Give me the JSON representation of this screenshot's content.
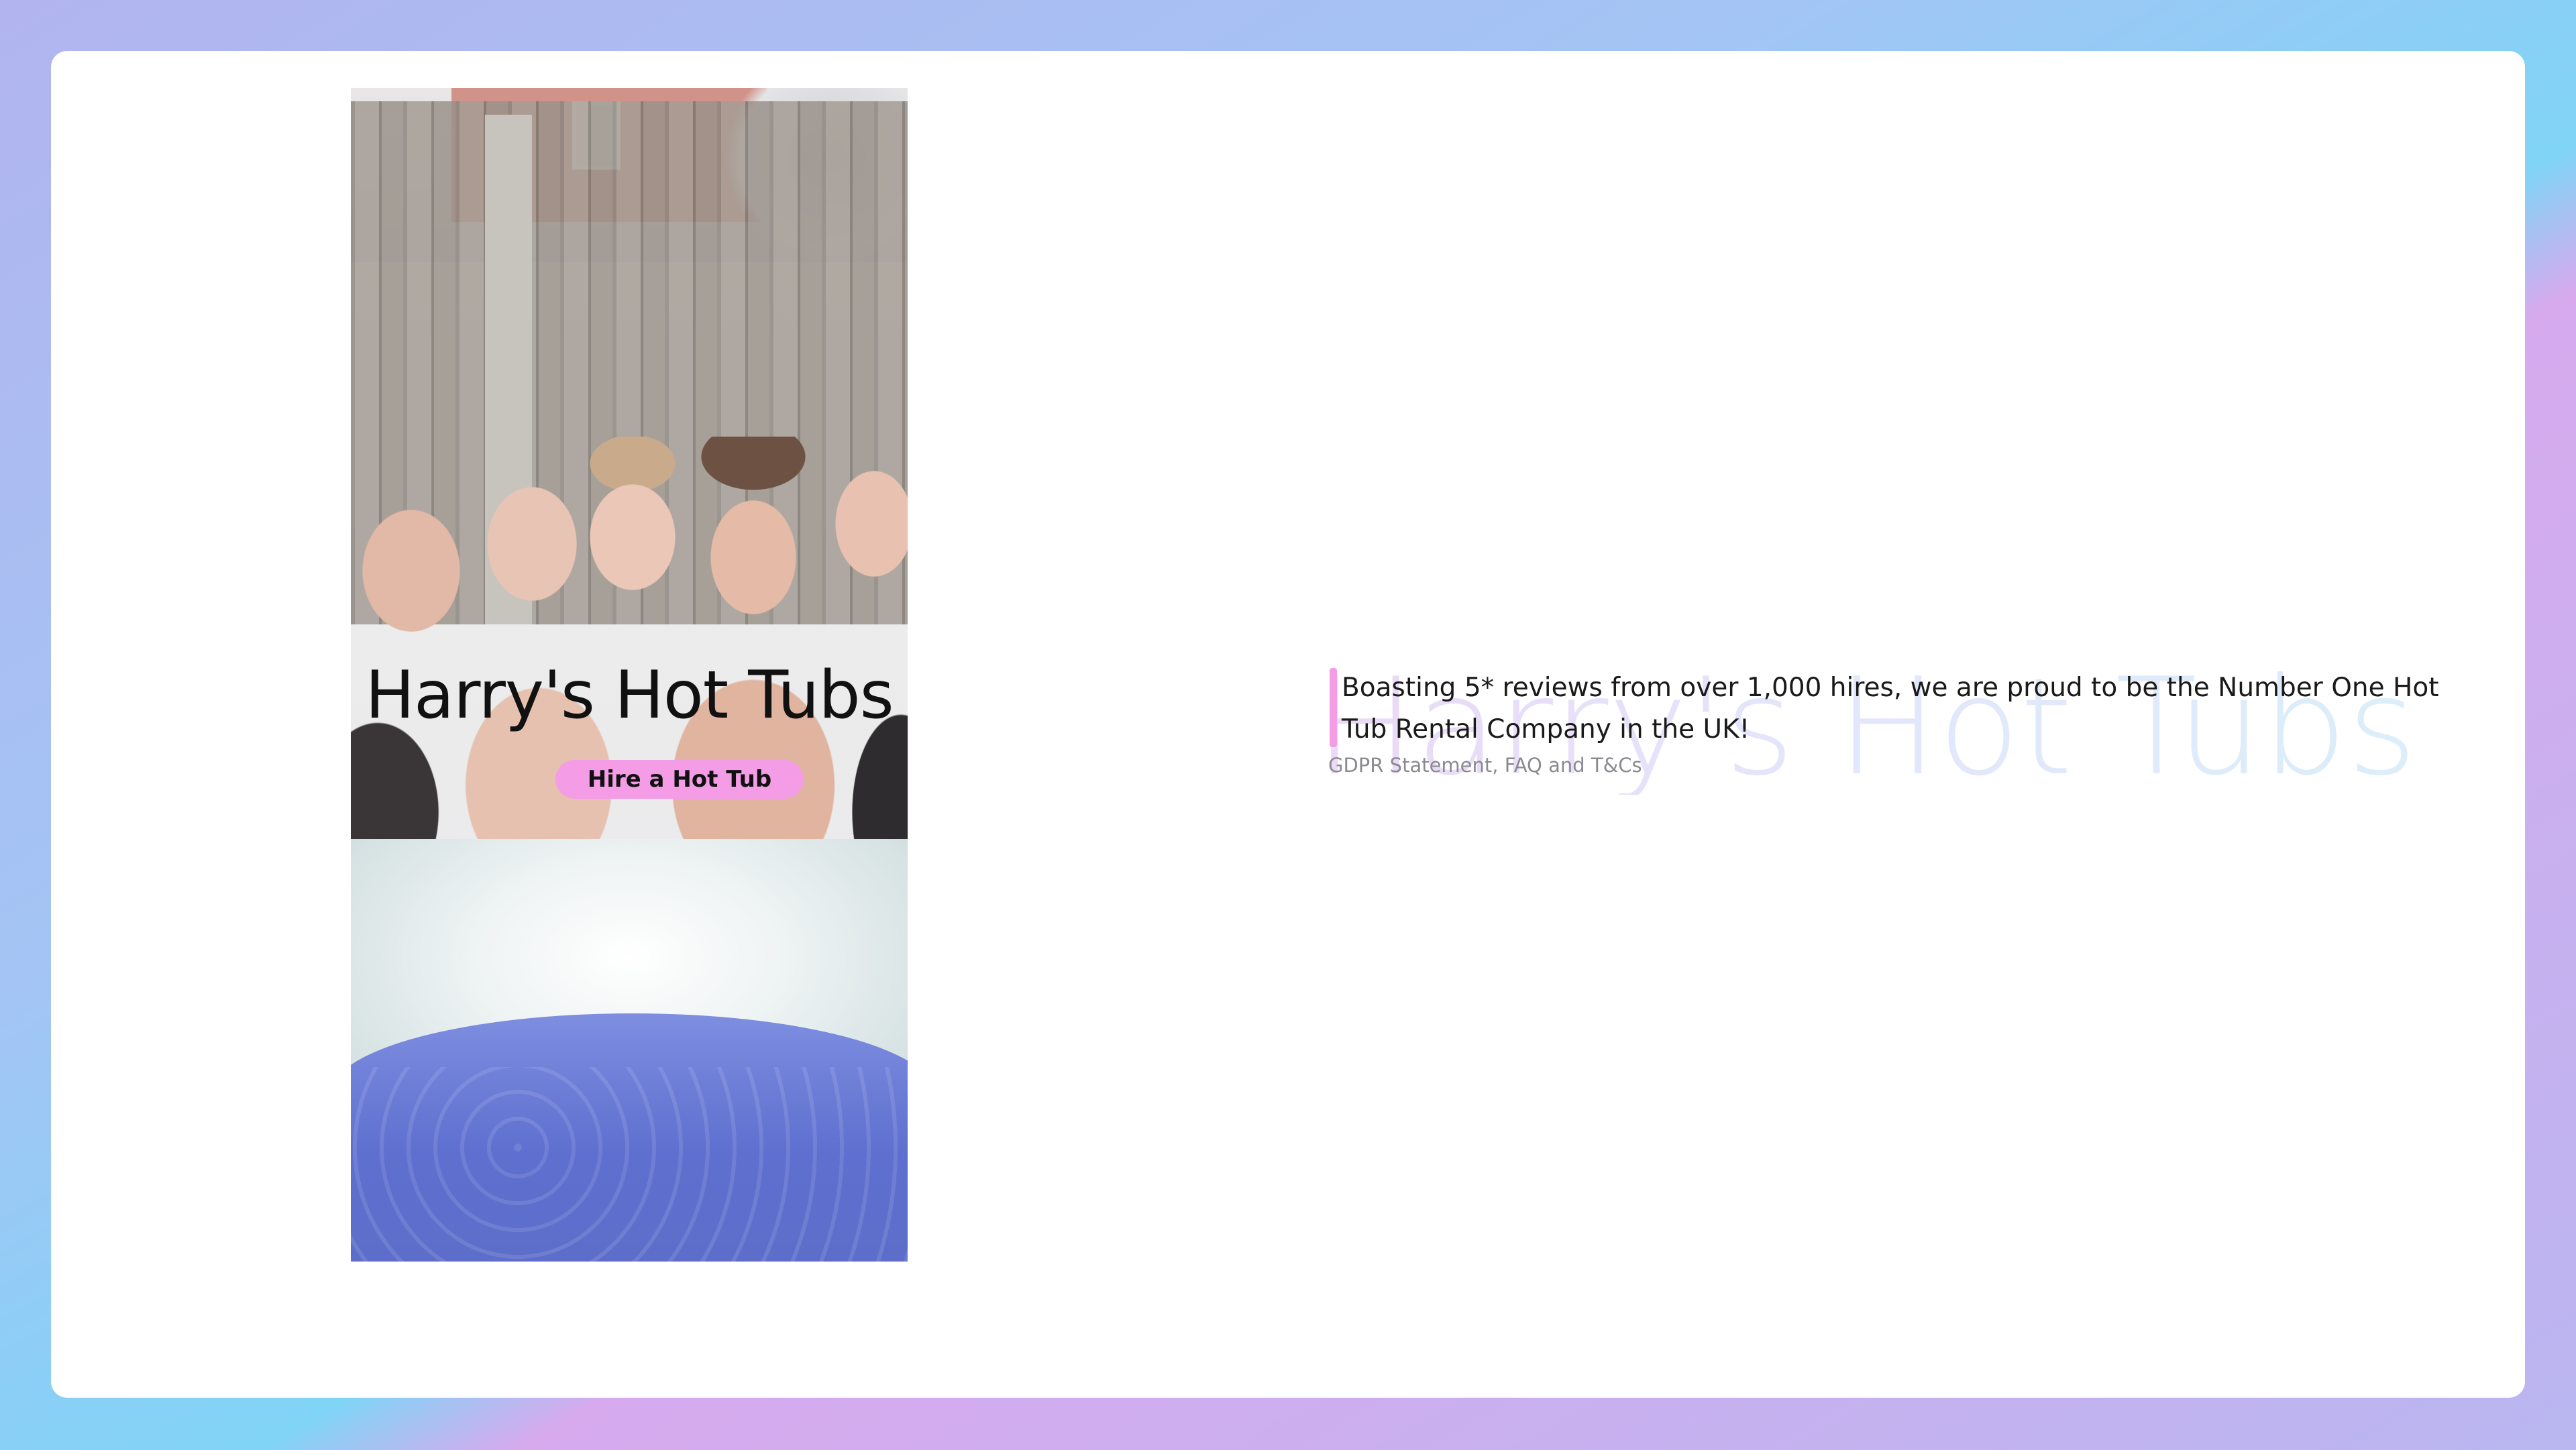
{
  "hero": {
    "title": "Harry's Hot Tubs",
    "cta_label": "Hire a Hot Tub"
  },
  "about": {
    "watermark": "Harry's Hot Tubs",
    "blurb": "Boasting 5* reviews from over 1,000 hires, we are proud to be the Number One Hot Tub Rental Company in the UK!",
    "footer_link": "GDPR Statement, FAQ and T&Cs"
  },
  "colors": {
    "accent": "#f49ce6",
    "card": "#ffffff",
    "text": "#111111",
    "muted": "#8a8a90"
  }
}
